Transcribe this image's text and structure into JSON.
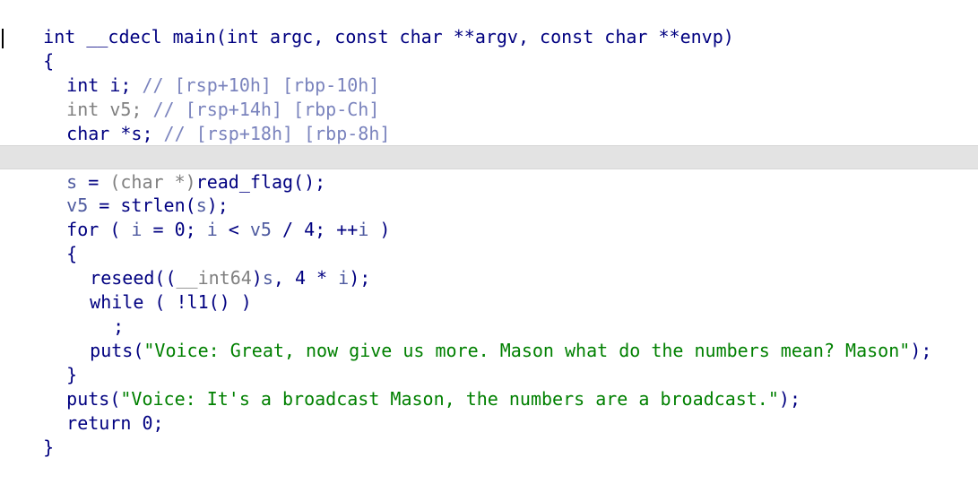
{
  "code": {
    "signature": "int __cdecl main(int argc, const char **argv, const char **envp)",
    "open_brace": "{",
    "decl_i": {
      "code": "int i;",
      "comment": "// [rsp+10h] [rbp-10h]"
    },
    "decl_v5": {
      "type": "int",
      "name": "v5;",
      "comment": "// [rsp+14h] [rbp-Ch]"
    },
    "decl_s": {
      "code": "char *s;",
      "comment": "// [rsp+18h] [rbp-8h]"
    },
    "l_s_assign": {
      "var": "s",
      "eq": " = ",
      "cast": "(char *)",
      "call": "read_flag();"
    },
    "l_v5_assign": {
      "var": "v5",
      "eq": " = ",
      "call": "strlen(",
      "arg": "s",
      "close": ");"
    },
    "l_for": {
      "kw": "for ( ",
      "v1": "i",
      "p1": " = 0; ",
      "v2": "i",
      "p2": " < ",
      "v3": "v5",
      "p3": " / 4; ++",
      "v4": "i",
      "p4": " )"
    },
    "loop_open": "{",
    "l_reseed": {
      "call": "reseed((",
      "cast": "__int64",
      "close1": ")",
      "v1": "s",
      "mid": ", 4 * ",
      "v2": "i",
      "close2": ");"
    },
    "l_while": "while ( !l1() )",
    "l_semicolon": ";",
    "l_puts1": {
      "call": "puts(",
      "str": "\"Voice: Great, now give us more. Mason what do the numbers mean? Mason\"",
      "close": ");"
    },
    "loop_close": "}",
    "l_puts2": {
      "call": "puts(",
      "str": "\"Voice: It's a broadcast Mason, the numbers are a broadcast.\"",
      "close": ");"
    },
    "l_return": "return 0;",
    "close_brace": "}"
  }
}
